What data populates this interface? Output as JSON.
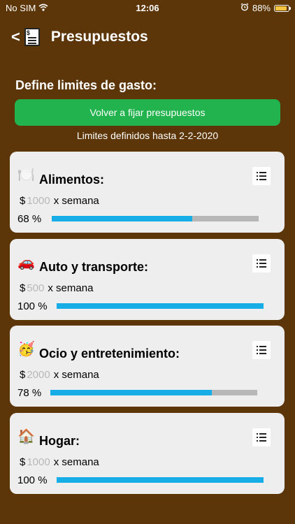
{
  "status_bar": {
    "carrier": "No SIM",
    "time": "12:06",
    "battery": "88%",
    "battery_level": 0.88
  },
  "nav": {
    "back_label": "<",
    "title": "Presupuestos",
    "icon_glyph": "$"
  },
  "section_label": "Define limites de gasto:",
  "reset_button": "Volver a fijar presupuestos",
  "limits_note": "Limites definidos hasta 2-2-2020",
  "categories": [
    {
      "emoji": "🍽️",
      "name": "Alimentos:",
      "currency": "$",
      "amount": "1000",
      "period": "x semana",
      "percent_label": "68 %",
      "progress": 0.68
    },
    {
      "emoji": "🚗",
      "name": "Auto y transporte:",
      "currency": "$",
      "amount": "500",
      "period": "x semana",
      "percent_label": "100 %",
      "progress": 1.0
    },
    {
      "emoji": "🥳",
      "name": "Ocio y entretenimiento:",
      "currency": "$",
      "amount": "2000",
      "period": "x semana",
      "percent_label": "78 %",
      "progress": 0.78
    },
    {
      "emoji": "🏠",
      "name": "Hogar:",
      "currency": "$",
      "amount": "1000",
      "period": "x semana",
      "percent_label": "100 %",
      "progress": 1.0
    }
  ],
  "colors": {
    "background": "#5c3609",
    "button": "#22b34e",
    "progress_fill": "#17aee8",
    "progress_track": "#b7b7b7",
    "card": "#eeeeee"
  }
}
